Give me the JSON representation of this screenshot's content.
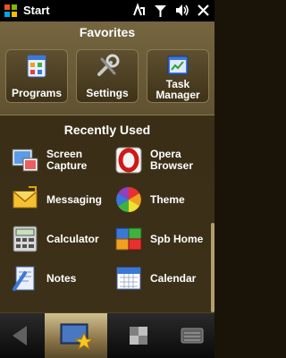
{
  "status_bar": {
    "title": "Start",
    "icons": [
      "windows-logo-icon",
      "connectivity-icon",
      "signal-icon",
      "volume-icon",
      "close-icon"
    ]
  },
  "favorites": {
    "header": "Favorites",
    "items": [
      {
        "label": "Programs",
        "icon": "programs-icon"
      },
      {
        "label": "Settings",
        "icon": "settings-icon"
      },
      {
        "label": "Task\nManager",
        "icon": "task-manager-icon"
      }
    ]
  },
  "recent": {
    "header": "Recently Used",
    "items": [
      {
        "label": "Screen\nCapture",
        "icon": "screen-capture-icon"
      },
      {
        "label": "Opera\nBrowser",
        "icon": "opera-icon"
      },
      {
        "label": "Messaging",
        "icon": "messaging-icon"
      },
      {
        "label": "Theme",
        "icon": "theme-icon"
      },
      {
        "label": "Calculator",
        "icon": "calculator-icon"
      },
      {
        "label": "Spb Home",
        "icon": "spb-home-icon"
      },
      {
        "label": "Notes",
        "icon": "notes-icon"
      },
      {
        "label": "Calendar",
        "icon": "calendar-icon"
      }
    ]
  },
  "bottom_bar": {
    "items": [
      "back-arrow-icon",
      "favorites-tab-icon",
      "grid-tab-icon",
      "menu-icon"
    ]
  }
}
